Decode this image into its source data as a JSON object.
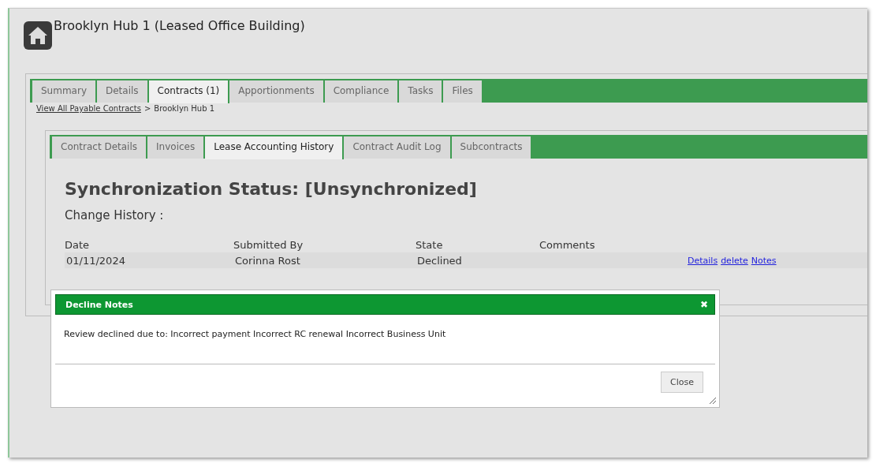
{
  "page": {
    "title": "Brooklyn Hub 1 (Leased Office Building)"
  },
  "tabs": [
    {
      "label": "Summary",
      "selected": false
    },
    {
      "label": "Details",
      "selected": false
    },
    {
      "label": "Contracts (1)",
      "selected": true
    },
    {
      "label": "Apportionments",
      "selected": false
    },
    {
      "label": "Compliance",
      "selected": false
    },
    {
      "label": "Tasks",
      "selected": false
    },
    {
      "label": "Files",
      "selected": false
    }
  ],
  "breadcrumb": {
    "link": "View All Payable Contracts",
    "separator": ">",
    "current": "Brooklyn Hub 1"
  },
  "subtabs": [
    {
      "label": "Contract Details",
      "selected": false
    },
    {
      "label": "Invoices",
      "selected": false
    },
    {
      "label": "Lease Accounting History",
      "selected": true
    },
    {
      "label": "Contract Audit Log",
      "selected": false
    },
    {
      "label": "Subcontracts",
      "selected": false
    }
  ],
  "status_heading": "Synchronization Status: [Unsynchronized]",
  "section_title": "Change History :",
  "table": {
    "columns": [
      "Date",
      "Submitted By",
      "State",
      "Comments"
    ],
    "rows": [
      {
        "cells": [
          "01/11/2024",
          "Corinna Rost",
          "Declined",
          ""
        ],
        "links": [
          "Details",
          "delete",
          "Notes"
        ]
      }
    ]
  },
  "dialog": {
    "title": "Decline Notes",
    "close_icon": "✖",
    "body": "Review declined due to: Incorrect payment Incorrect RC renewal Incorrect Business Unit",
    "buttons": [
      "Close"
    ]
  }
}
